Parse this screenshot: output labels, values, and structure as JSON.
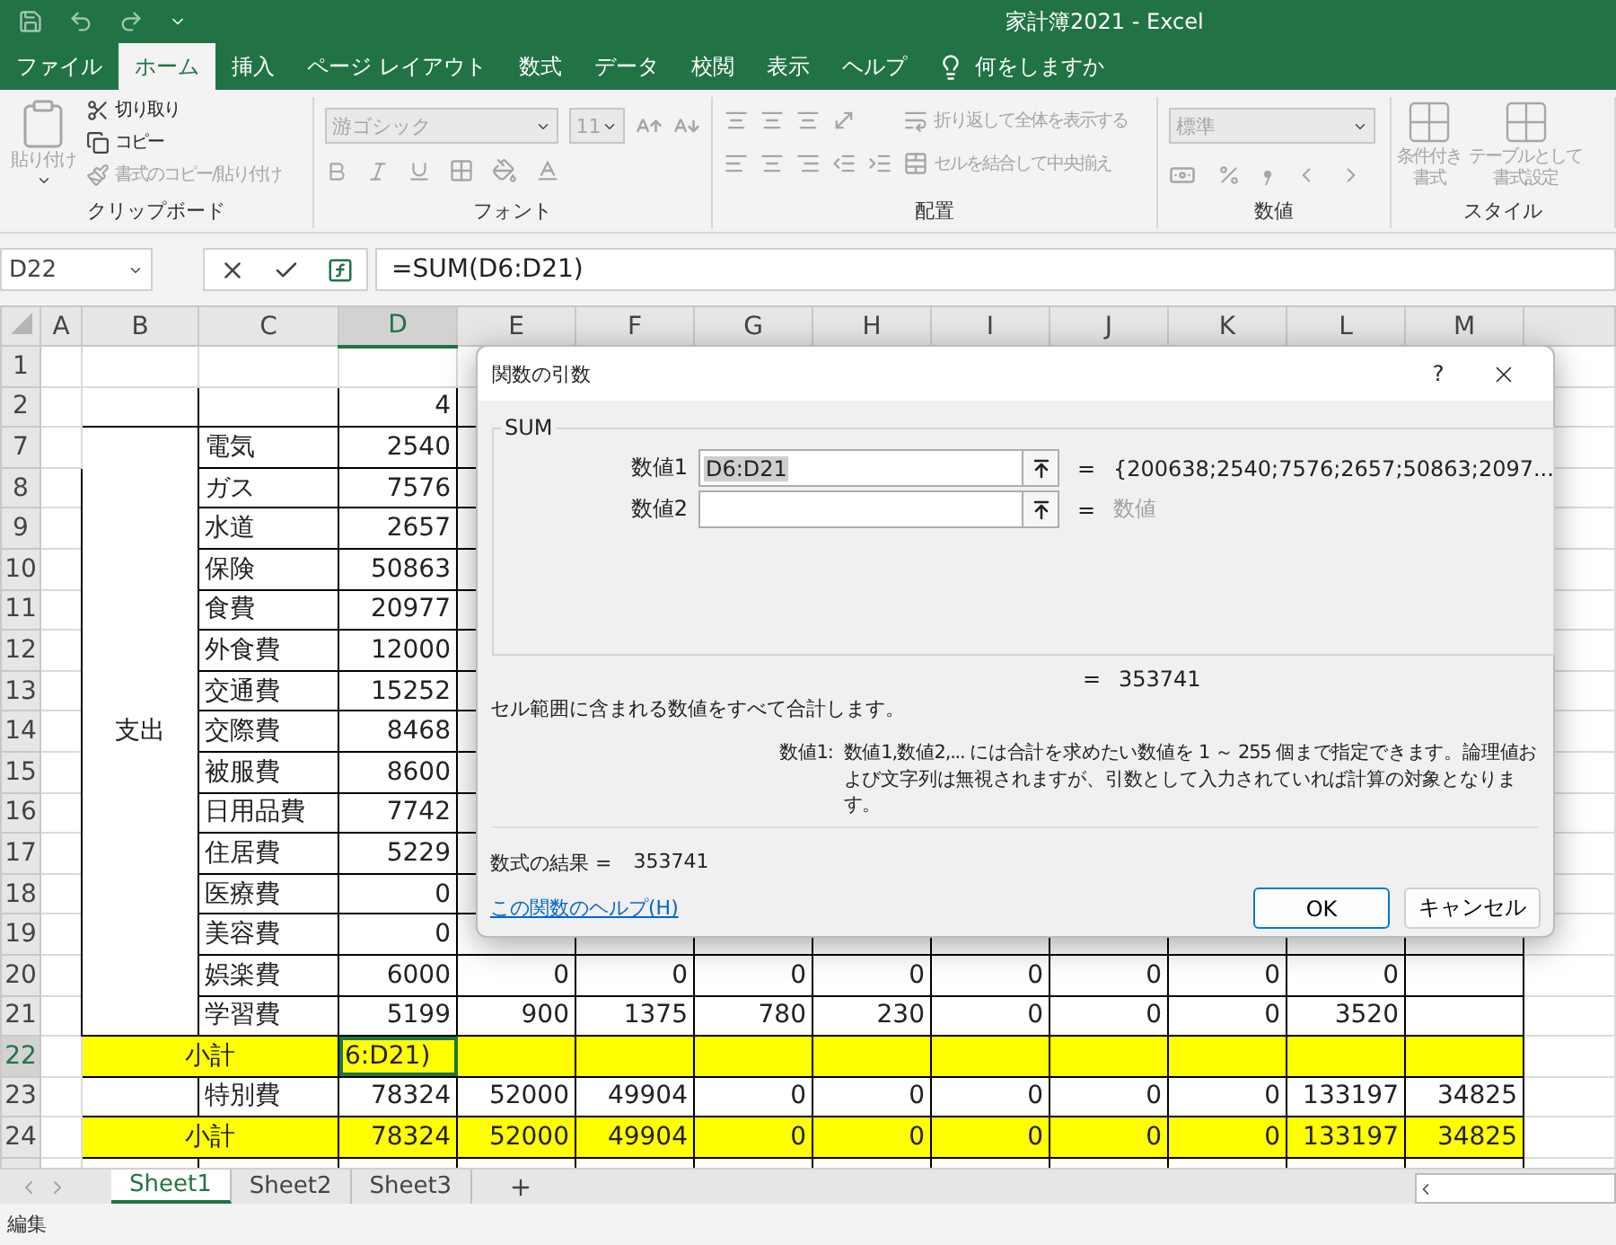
{
  "window": {
    "title": "家計簿2021 - Excel"
  },
  "ribbon_tabs": [
    {
      "label": "ファイル",
      "selected": false
    },
    {
      "label": "ホーム",
      "selected": true
    },
    {
      "label": "挿入",
      "selected": false
    },
    {
      "label": "ページ レイアウト",
      "selected": false
    },
    {
      "label": "数式",
      "selected": false
    },
    {
      "label": "データ",
      "selected": false
    },
    {
      "label": "校閲",
      "selected": false
    },
    {
      "label": "表示",
      "selected": false
    },
    {
      "label": "ヘルプ",
      "selected": false
    }
  ],
  "tell_me": "何をしますか",
  "ribbon_groups": [
    {
      "kind": "clipboard",
      "label": "クリップボード",
      "items": [
        {
          "label": "貼り付け",
          "disabled": true
        },
        {
          "label": "切り取り",
          "disabled": false
        },
        {
          "label": "コピー",
          "disabled": false
        },
        {
          "label": "書式のコピー/貼り付け",
          "disabled": true
        }
      ]
    },
    {
      "kind": "font",
      "label": "フォント",
      "font_name": "游ゴシック",
      "font_size": "11",
      "disabled": true
    },
    {
      "kind": "alignment",
      "label": "配置",
      "items": [
        {
          "label": "折り返して全体を表示する",
          "disabled": true
        },
        {
          "label": "セルを結合して中央揃え",
          "disabled": true
        }
      ]
    },
    {
      "kind": "number",
      "label": "数値",
      "format": "標準",
      "disabled": true
    },
    {
      "kind": "styles",
      "label": "スタイル",
      "items": [
        {
          "lines": [
            "条件付き",
            "書式"
          ],
          "disabled": true
        },
        {
          "lines": [
            "テーブルとして",
            "書式設定"
          ],
          "disabled": true
        }
      ]
    }
  ],
  "formula_bar": {
    "name_box": "D22",
    "formula": "=SUM(D6:D21)"
  },
  "sheet": {
    "columns": [
      {
        "label": "A",
        "selected": false
      },
      {
        "label": "B",
        "selected": false
      },
      {
        "label": "C",
        "selected": false
      },
      {
        "label": "D",
        "selected": true
      },
      {
        "label": "E",
        "selected": false
      },
      {
        "label": "F",
        "selected": false
      },
      {
        "label": "G",
        "selected": false
      },
      {
        "label": "H",
        "selected": false
      },
      {
        "label": "I",
        "selected": false
      },
      {
        "label": "J",
        "selected": false
      },
      {
        "label": "K",
        "selected": false
      },
      {
        "label": "L",
        "selected": false
      },
      {
        "label": "M",
        "selected": false
      }
    ],
    "category": "支出",
    "rows": [
      {
        "number": "1",
        "kind": "blank",
        "selected": false
      },
      {
        "number": "2",
        "kind": "top",
        "selected": false,
        "values": {
          "D": "4"
        }
      },
      {
        "number": "7",
        "kind": "item",
        "selected": false,
        "label": "電気",
        "values": {
          "D": "2540"
        }
      },
      {
        "number": "8",
        "kind": "item",
        "selected": false,
        "label": "ガス",
        "values": {
          "D": "7576"
        }
      },
      {
        "number": "9",
        "kind": "item",
        "selected": false,
        "label": "水道",
        "values": {
          "D": "2657"
        }
      },
      {
        "number": "10",
        "kind": "item",
        "selected": false,
        "label": "保険",
        "values": {
          "D": "50863"
        }
      },
      {
        "number": "11",
        "kind": "item",
        "selected": false,
        "label": "食費",
        "values": {
          "D": "20977"
        }
      },
      {
        "number": "12",
        "kind": "item",
        "selected": false,
        "label": "外食費",
        "values": {
          "D": "12000"
        }
      },
      {
        "number": "13",
        "kind": "item",
        "selected": false,
        "label": "交通費",
        "values": {
          "D": "15252"
        }
      },
      {
        "number": "14",
        "kind": "item",
        "selected": false,
        "label": "交際費",
        "values": {
          "D": "8468"
        }
      },
      {
        "number": "15",
        "kind": "item",
        "selected": false,
        "label": "被服費",
        "values": {
          "D": "8600"
        }
      },
      {
        "number": "16",
        "kind": "item",
        "selected": false,
        "label": "日用品費",
        "values": {
          "D": "7742"
        }
      },
      {
        "number": "17",
        "kind": "item",
        "selected": false,
        "label": "住居費",
        "values": {
          "D": "5229"
        }
      },
      {
        "number": "18",
        "kind": "item",
        "selected": false,
        "label": "医療費",
        "values": {
          "D": "0"
        }
      },
      {
        "number": "19",
        "kind": "item",
        "selected": false,
        "label": "美容費",
        "values": {
          "D": "0"
        }
      },
      {
        "number": "20",
        "kind": "item",
        "selected": false,
        "label": "娯楽費",
        "values": {
          "D": "6000",
          "E": "0",
          "F": "0",
          "G": "0",
          "H": "0",
          "I": "0",
          "J": "0",
          "K": "0",
          "L": "0"
        }
      },
      {
        "number": "21",
        "kind": "item",
        "selected": false,
        "label": "学習費",
        "values": {
          "D": "5199",
          "E": "900",
          "F": "1375",
          "G": "780",
          "H": "230",
          "I": "0",
          "J": "0",
          "K": "0",
          "L": "3520"
        }
      },
      {
        "number": "22",
        "kind": "subtotal",
        "selected": true,
        "label": "小計",
        "editing": "6:D21)",
        "values": {}
      },
      {
        "number": "23",
        "kind": "special",
        "selected": false,
        "label": "特別費",
        "values": {
          "D": "78324",
          "E": "52000",
          "F": "49904",
          "G": "0",
          "H": "0",
          "I": "0",
          "J": "0",
          "K": "0",
          "L": "133197",
          "M": "34825"
        }
      },
      {
        "number": "24",
        "kind": "subtotal",
        "selected": false,
        "label": "小計",
        "values": {
          "D": "78324",
          "E": "52000",
          "F": "49904",
          "G": "0",
          "H": "0",
          "I": "0",
          "J": "0",
          "K": "0",
          "L": "133197",
          "M": "34825"
        }
      }
    ]
  },
  "dialog": {
    "title": "関数の引数",
    "help": "?",
    "function": "SUM",
    "args": [
      {
        "label": "数値1",
        "value": "D6:D21",
        "equals": "=",
        "result": "{200638;2540;7576;2657;50863;2097..."
      },
      {
        "label": "数値2",
        "equals": "=",
        "hint": "数値"
      }
    ],
    "total_equals": "=",
    "total": "353741",
    "description": "セル範囲に含まれる数値をすべて合計します。",
    "arg_help_label": "数値1:",
    "arg_help": "数値1,数値2,... には合計を求めたい数値を 1 ～ 255 個まで指定できます。論理値および文字列は無視されますが、引数として入力されていれば計算の対象となります。",
    "result_label": "数式の結果 =",
    "result": "353741",
    "help_link": "この関数のヘルプ(H)",
    "buttons": [
      {
        "label": "OK",
        "kind": "default"
      },
      {
        "label": "キャンセル",
        "kind": "normal"
      }
    ]
  },
  "sheet_tabs": [
    {
      "label": "Sheet1",
      "selected": true
    },
    {
      "label": "Sheet2",
      "selected": false
    },
    {
      "label": "Sheet3",
      "selected": false
    }
  ],
  "status": "編集"
}
